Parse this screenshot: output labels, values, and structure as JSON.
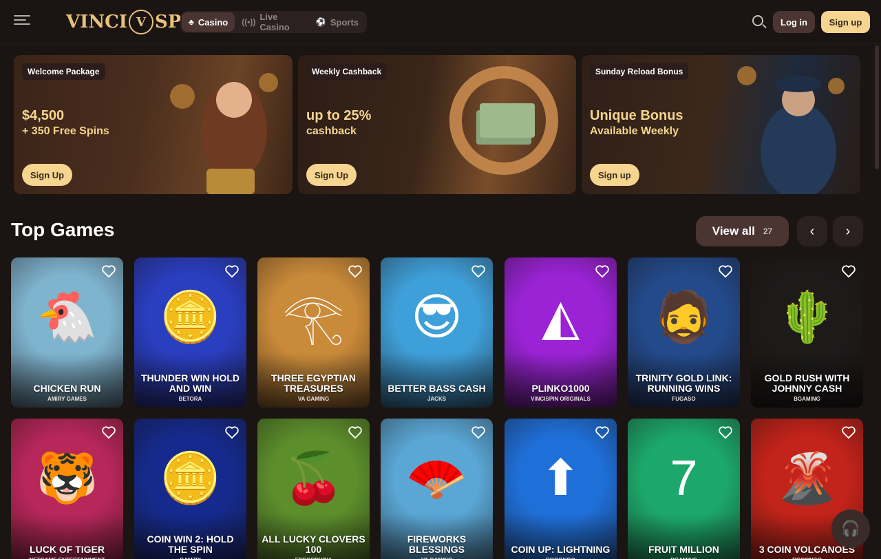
{
  "header": {
    "logo_left": "VINCI",
    "logo_mark": "V",
    "logo_right": "SPIN",
    "tabs": [
      {
        "label": "Casino",
        "icon": "cards-icon",
        "active": true
      },
      {
        "label": "Live Casino",
        "icon": "broadcast-icon",
        "active": false
      },
      {
        "label": "Sports",
        "icon": "ball-icon",
        "active": false
      }
    ],
    "login_label": "Log in",
    "signup_label": "Sign up"
  },
  "promos": [
    {
      "tag": "Welcome Package",
      "headline": "$4,500",
      "sub": "+ 350 Free Spins",
      "button": "Sign Up"
    },
    {
      "tag": "Weekly Cashback",
      "headline": "up to 25%",
      "sub": "cashback",
      "button": "Sign Up"
    },
    {
      "tag": "Sunday Reload Bonus",
      "headline": "Unique Bonus",
      "sub": "Available Weekly",
      "button": "Sign up"
    }
  ],
  "section": {
    "title": "Top Games",
    "view_all_label": "View all",
    "view_all_count": "27"
  },
  "games": [
    {
      "title": "Chicken Run",
      "provider": "Amiry Games",
      "color": "#7fb4cf",
      "art": "🐔"
    },
    {
      "title": "Thunder Win Hold and Win",
      "provider": "Betora",
      "color": "#2a3ec0",
      "art": "🪙"
    },
    {
      "title": "Three Egyptian Treasures",
      "provider": "VA Gaming",
      "color": "#c98a3a",
      "art": "𓂀"
    },
    {
      "title": "Better Bass Cash",
      "provider": "Jacks",
      "color": "#3f9fd8",
      "art": "😎"
    },
    {
      "title": "Plinko1000",
      "provider": "VinciSpin Originals",
      "color": "#9a23d6",
      "art": "◭"
    },
    {
      "title": "Trinity Gold Link: Running Wins",
      "provider": "Fugaso",
      "color": "#234a8a",
      "art": "🧔"
    },
    {
      "title": "Gold Rush with Johnny Cash",
      "provider": "BGaming",
      "color": "#1c1b1a",
      "art": "🌵"
    },
    {
      "title": "Luck of Tiger",
      "provider": "Netgame Entertainment",
      "color": "#b8275a",
      "art": "🐯"
    },
    {
      "title": "Coin Win 2: Hold the Spin",
      "provider": "Gamzix",
      "color": "#152a8c",
      "art": "🪙"
    },
    {
      "title": "All Lucky Clovers 100",
      "provider": "Endorphina",
      "color": "#5c8e2c",
      "art": "🍒"
    },
    {
      "title": "Fireworks Blessings",
      "provider": "VA Gaming",
      "color": "#5aa6d4",
      "art": "🪭"
    },
    {
      "title": "Coin Up: Lightning",
      "provider": "Booongo",
      "color": "#1f6fd8",
      "art": "⬆"
    },
    {
      "title": "Fruit Million",
      "provider": "BGaming",
      "color": "#1ca86a",
      "art": "7"
    },
    {
      "title": "3 Coin Volcanoes",
      "provider": "Booongo",
      "color": "#c2231a",
      "art": "🌋"
    }
  ]
}
